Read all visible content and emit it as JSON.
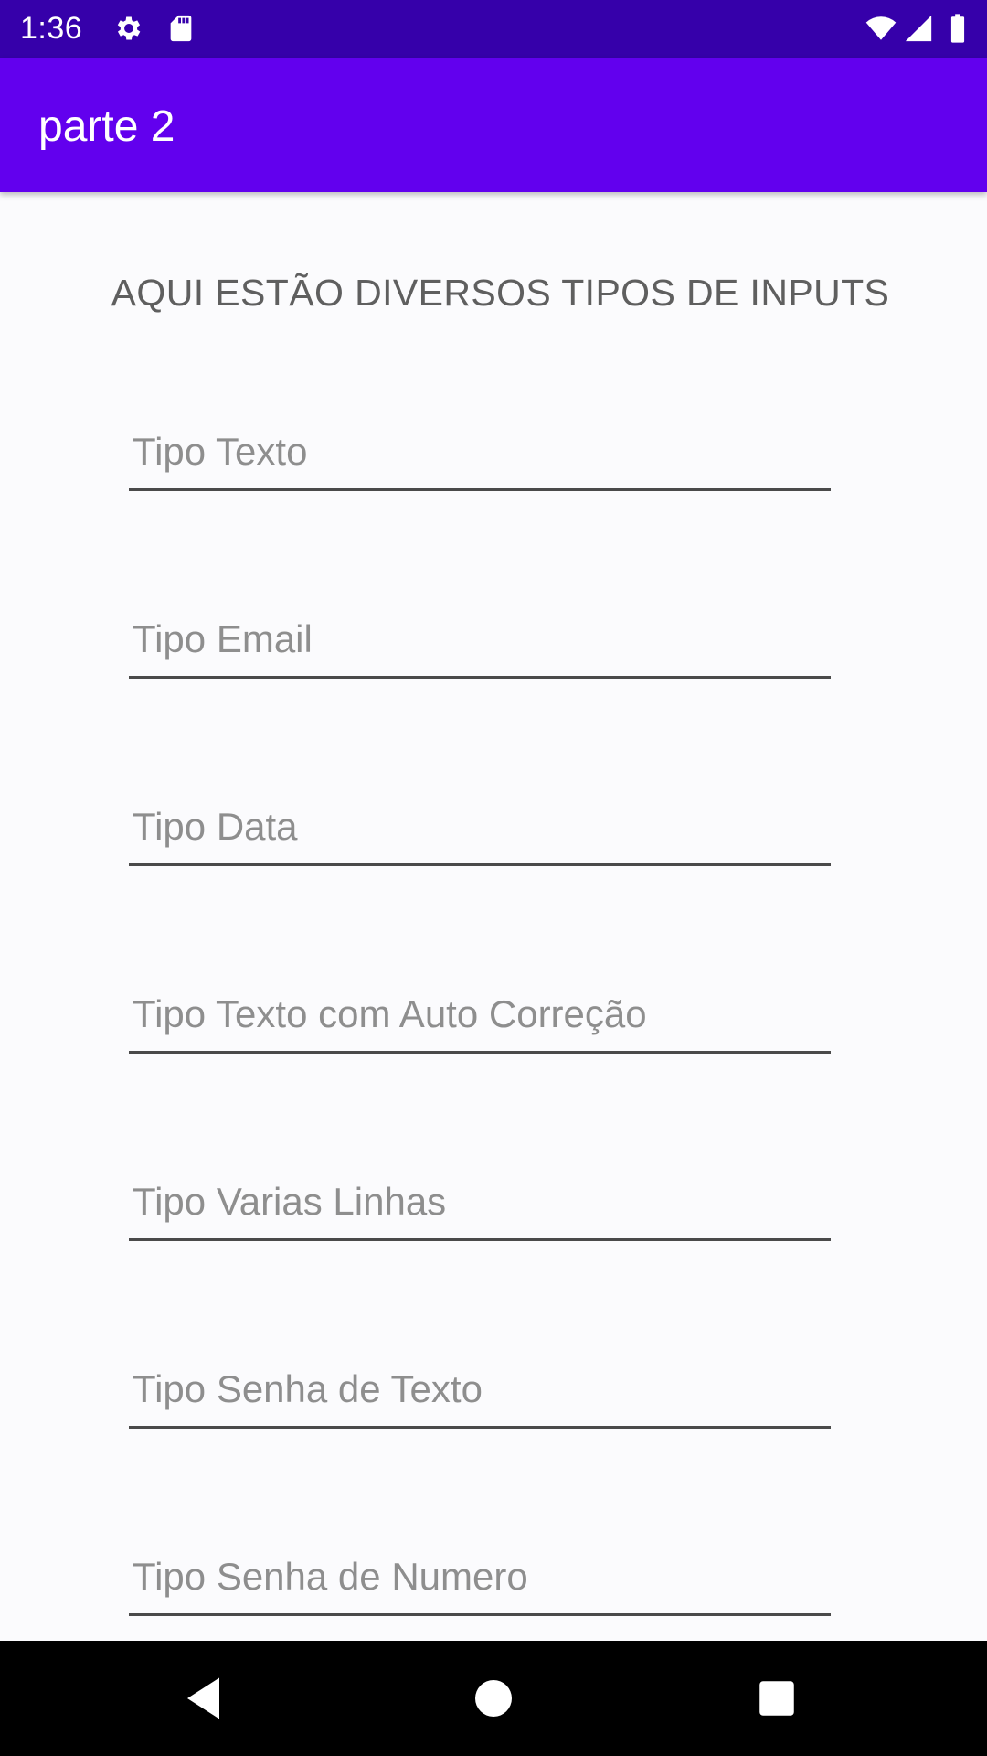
{
  "status_bar": {
    "time": "1:36",
    "icons": [
      "gear-icon",
      "sd-card-icon",
      "wifi-icon",
      "signal-icon",
      "battery-icon"
    ],
    "background": "#3600aa"
  },
  "app_bar": {
    "title": "parte 2",
    "background": "#6200ee"
  },
  "main": {
    "heading": "AQUI ESTÃO DIVERSOS TIPOS DE INPUTS",
    "fields": [
      {
        "name": "text-input",
        "type": "text",
        "placeholder": "Tipo Texto",
        "value": ""
      },
      {
        "name": "email-input",
        "type": "email",
        "placeholder": "Tipo Email",
        "value": ""
      },
      {
        "name": "date-input",
        "type": "text",
        "placeholder": "Tipo Data",
        "value": ""
      },
      {
        "name": "autocorrect-text-input",
        "type": "text",
        "placeholder": "Tipo Texto com Auto Correção",
        "value": ""
      },
      {
        "name": "multiline-input",
        "type": "text",
        "placeholder": "Tipo Varias Linhas",
        "value": ""
      },
      {
        "name": "text-password-input",
        "type": "password",
        "placeholder": "Tipo Senha de Texto",
        "value": ""
      },
      {
        "name": "number-password-input",
        "type": "password",
        "placeholder": "Tipo Senha de Numero",
        "value": ""
      }
    ]
  },
  "nav_bar": {
    "buttons": [
      "back-icon",
      "home-icon",
      "recents-icon"
    ]
  }
}
